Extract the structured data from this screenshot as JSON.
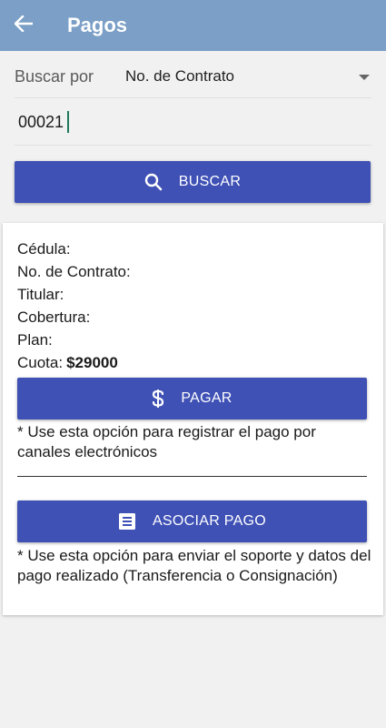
{
  "appbar": {
    "title": "Pagos"
  },
  "search": {
    "label": "Buscar por",
    "selected_option": "No. de Contrato",
    "input_value": "00021",
    "button_label": "BUSCAR"
  },
  "result": {
    "fields": [
      {
        "label": "Cédula:",
        "value": ""
      },
      {
        "label": "No. de Contrato:",
        "value": ""
      },
      {
        "label": "Titular:",
        "value": ""
      },
      {
        "label": "Cobertura:",
        "value": ""
      },
      {
        "label": "Plan:",
        "value": ""
      },
      {
        "label": "Cuota:",
        "value": "$29000"
      }
    ],
    "pay_button_label": "PAGAR",
    "pay_note": "* Use esta opción para registrar el pago por canales electrónicos",
    "associate_button_label": "ASOCIAR PAGO",
    "associate_note": "* Use esta opción para enviar el soporte y datos del pago realizado (Transferencia o Consignación)"
  },
  "icons": {
    "back": "arrow-left-icon",
    "dropdown": "caret-down-icon",
    "search": "search-icon",
    "dollar": "dollar-icon",
    "receipt": "receipt-icon"
  },
  "colors": {
    "appbar": "#7b9fc6",
    "primary_button": "#3f51b5",
    "background": "#f1f1f1"
  }
}
